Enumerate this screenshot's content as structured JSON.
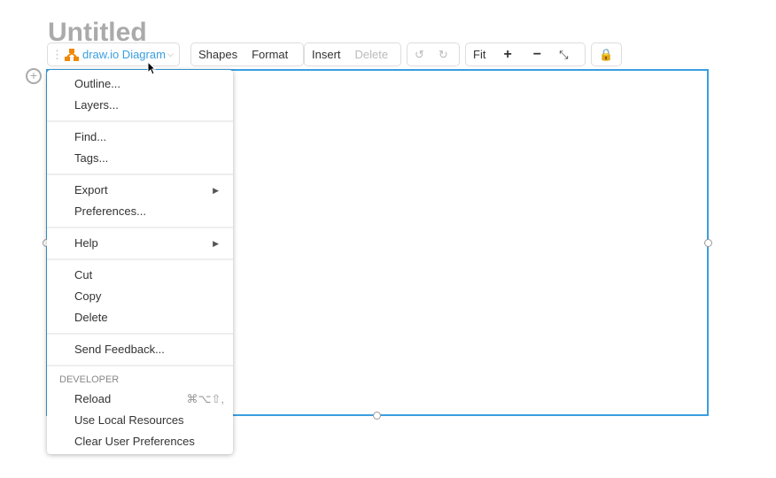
{
  "title": "Untitled",
  "toolbar": {
    "diagram_label": "draw.io Diagram",
    "shapes": "Shapes",
    "format": "Format",
    "insert": "Insert",
    "delete": "Delete",
    "fit": "Fit",
    "zoom_in": "+",
    "zoom_out": "−",
    "accent": "#3a9ee0"
  },
  "menu": {
    "g1": [
      "Outline...",
      "Layers..."
    ],
    "g2": [
      "Find...",
      "Tags..."
    ],
    "g3": [
      "Export",
      "Preferences..."
    ],
    "g4": [
      "Help"
    ],
    "g5": [
      "Cut",
      "Copy",
      "Delete"
    ],
    "g6": [
      "Send Feedback..."
    ],
    "developer_header": "DEVELOPER",
    "reload": "Reload",
    "reload_shortcut": "⌘⌥⇧,",
    "local": "Use Local Resources",
    "clear": "Clear User Preferences"
  }
}
